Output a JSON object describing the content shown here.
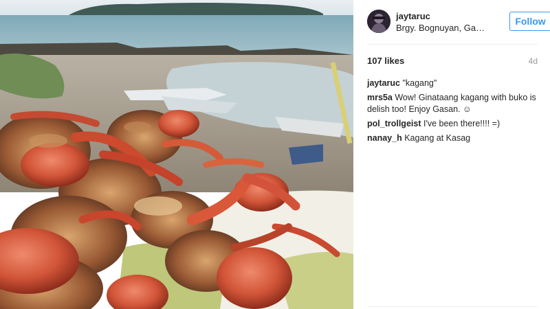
{
  "post": {
    "username": "jaytaruc",
    "location": "Brgy. Bognuyan, Gasan, Marinduque",
    "follow_label": "Follow",
    "likes": "107 likes",
    "time_ago": "4d"
  },
  "comments": [
    {
      "author": "jaytaruc",
      "text": "\"kagang\""
    },
    {
      "author": "mrs5a",
      "text": "Wow! Ginataang kagang with buko is delish too! Enjoy Gasan. ☺"
    },
    {
      "author": "pol_trollgeist",
      "text": "I've been there!!!! =)"
    },
    {
      "author": "nanay_h",
      "text": "Kagang at Kasag"
    }
  ],
  "icons": {
    "avatar": "profile-avatar",
    "photo": "fried-crabs-beach-photo"
  },
  "colors": {
    "accent": "#3897f0",
    "text": "#262626",
    "muted": "#999999",
    "divider": "#efefef"
  }
}
